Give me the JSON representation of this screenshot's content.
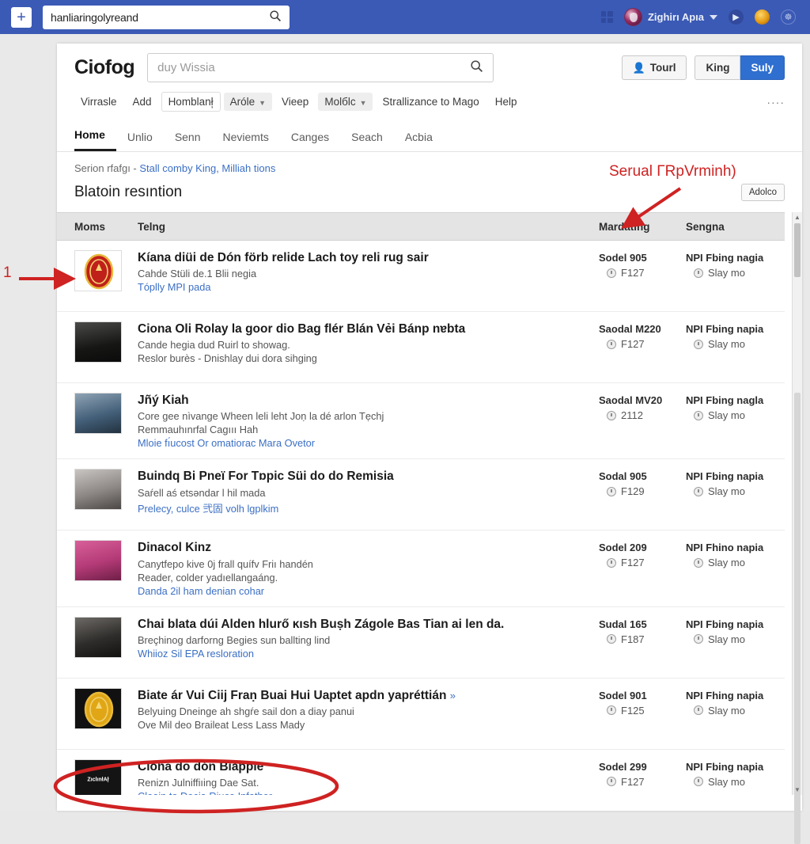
{
  "browser": {
    "new_tab_label": "+",
    "omnibox_value": "hanliaringolyreand",
    "omnibox_search_icon": "search-icon",
    "apps_icon": "grid-icon",
    "user_name": "Zighirı Apıa",
    "user_caret": "▼",
    "icon_play": "▶",
    "icon_badge": "●",
    "icon_globe": "☸"
  },
  "app": {
    "brand": "Ciofog",
    "search_placeholder": "duy Wissia",
    "search_icon": "search-icon",
    "buttons": {
      "tour": "Tourl",
      "person_icon": "person-icon",
      "king": "King",
      "suly": "Suly"
    },
    "toolbar": [
      {
        "label": "Virrasle",
        "style": "plain",
        "caret": false
      },
      {
        "label": "Add",
        "style": "plain",
        "caret": false
      },
      {
        "label": "Homblanł̦",
        "style": "boxed",
        "caret": false
      },
      {
        "label": "Aróle",
        "style": "filled",
        "caret": true
      },
      {
        "label": "Vieep",
        "style": "plain",
        "caret": false
      },
      {
        "label": "Molбlc",
        "style": "filled",
        "caret": true
      },
      {
        "label": "Strallizance to Mago",
        "style": "plain",
        "caret": false
      },
      {
        "label": "Help",
        "style": "plain",
        "caret": false
      }
    ],
    "toolbar_overflow": "····",
    "tabs": [
      {
        "label": "Home",
        "active": true
      },
      {
        "label": "Unlio",
        "active": false
      },
      {
        "label": "Senn",
        "active": false
      },
      {
        "label": "Neviemts",
        "active": false
      },
      {
        "label": "Canges",
        "active": false
      },
      {
        "label": "Seach",
        "active": false
      },
      {
        "label": "Acbia",
        "active": false
      }
    ],
    "breadcrumb": {
      "prefix": "Serion rfafgı - ",
      "link1": "Stall comby King,",
      "link2": " Milliah tions"
    },
    "section": {
      "title": "Blatoin resıntion",
      "action_button": "Adolco"
    },
    "columns": {
      "thumb": "Moms",
      "main": "Telng",
      "col_a": "Mardating",
      "col_b": "Sengna"
    }
  },
  "rows": [
    {
      "thumb_kind": "emblem-red",
      "thumb_label": "",
      "title": "Kíana diüi de Dón förb relide Lach toy reli rug sair",
      "title_tail": "",
      "sub": "Cahde Stüli de.1 Blii negia",
      "sub2": "",
      "link": "Tóplly MPI pada",
      "col_a_top": "Sodel 905",
      "col_a_bot": "F127",
      "col_b_top": "NPI Fbing nagia",
      "col_b_bot": "Slay mo"
    },
    {
      "thumb_kind": "photo-dark",
      "thumb_label": "",
      "title": "Ciona Oli Rolay la goor dio Bag flér Blán Vẻi Bánp nɐbta",
      "title_tail": "",
      "sub": "Cande hegia dud Ruirl to showag.",
      "sub2": "Reslor burès - Dnishlay dui dora sihging",
      "link": "",
      "col_a_top": "Saodal M220",
      "col_a_bot": "F127",
      "col_b_top": "NPI Fbing napia",
      "col_b_bot": "Slay mo"
    },
    {
      "thumb_kind": "photo-blue",
      "thumb_label": "",
      "title": "Jñý Kiah",
      "title_tail": "",
      "sub": "Core gee nìvange Wheen leli leht Joṇ la dé arlon Tẹchj",
      "sub2": "Remmauhınrfal Cagııı Hah",
      "link": "Mloie fı́ucost Or omatiorac Mara Ovetor",
      "col_a_top": "Saodal MV20",
      "col_a_bot": "2112",
      "col_b_top": "NPI Fbing nagla",
      "col_b_bot": "Slay mo"
    },
    {
      "thumb_kind": "photo-gray",
      "thumb_label": "",
      "title": "Buindq Bi Pneï For Tɒpic Süi do do Remisia",
      "title_tail": "",
      "sub": "Saŕell aś etsəndar l hil mada",
      "sub2": "",
      "link": "Prelecy, culce 弐固 volh lgplkim",
      "col_a_top": "Sodal 905",
      "col_a_bot": "F129",
      "col_b_top": "NPI Fbing napia",
      "col_b_bot": "Slay mo"
    },
    {
      "thumb_kind": "photo-pink",
      "thumb_label": "",
      "title": "Dinacol Kinz",
      "title_tail": "",
      "sub": "Canytfepo kive 0j frall quífv Friı handén",
      "sub2": "Reader, colder yadıellangaáng.",
      "link": "Dandа 2il ham denian cohar",
      "col_a_top": "Sodel 209",
      "col_a_bot": "F127",
      "col_b_top": "NPI Fhino napia",
      "col_b_bot": "Slay mo"
    },
    {
      "thumb_kind": "photo-hat",
      "thumb_label": "",
      "title": "Chai blata dúi Alden hlurő ĸısh Buṣh Zágole Bas Tian ai len da.",
      "title_tail": "",
      "sub": "Breçhinog darforng Begies sun ballting lind",
      "sub2": "",
      "link": "Whiioz Sil EPA resloration",
      "col_a_top": "Sudal 165",
      "col_a_bot": "F187",
      "col_b_top": "NPI Fbing napia",
      "col_b_bot": "Slay mo"
    },
    {
      "thumb_kind": "emblem-gold",
      "thumb_label": "",
      "title": "Biate ár Vui Ciij Fraṇ Buai Hui Uaptet apdn yapréttián",
      "title_tail": "»",
      "sub": "Belyuing Dneinge ah shgŕe sail don a diay panui",
      "sub2": "Ove Mil deo Braileat Less Lass Mady",
      "link": "",
      "col_a_top": "Sodel 901",
      "col_a_bot": "F125",
      "col_b_top": "NPI Fhing napia",
      "col_b_bot": "Slay mo"
    },
    {
      "thumb_kind": "photo-black",
      "thumb_label": "ZıclınłAł̦",
      "title": "Clona do dón Biápple",
      "title_tail": "",
      "sub": "Renizn Julniffiıing Dae Sat.",
      "sub2": "",
      "link": "Clooin to Decia Rjuce Infather",
      "col_a_top": "Sodel 299",
      "col_a_bot": "F127",
      "col_b_top": "NPI Fbing napia",
      "col_b_bot": "Slay mo"
    }
  ],
  "annotations": {
    "left_number": "1",
    "top_label": "Serual ΓRpVrminh)",
    "accent_color": "#cf2222"
  }
}
